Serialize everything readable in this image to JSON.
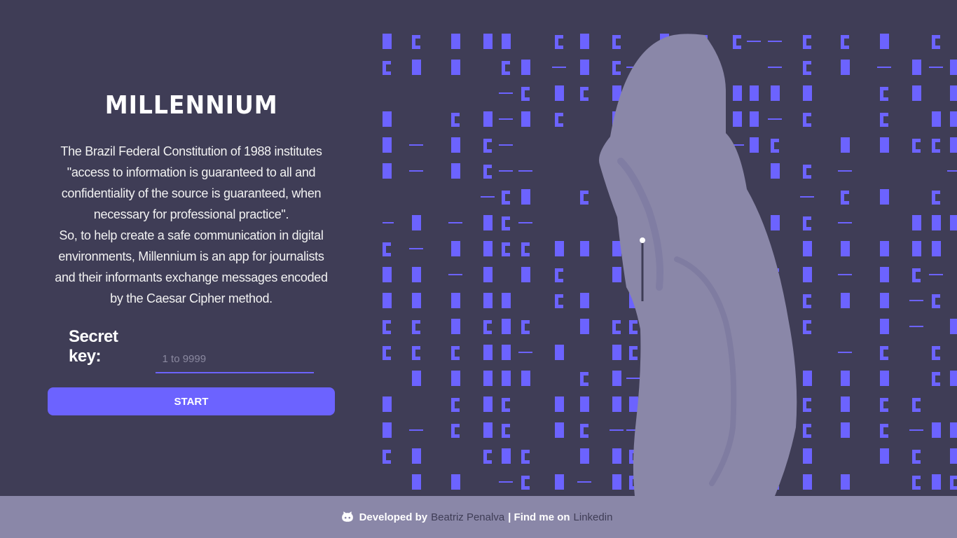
{
  "app": {
    "title": "MILLENNIUM"
  },
  "description": {
    "paragraph1": "The Brazil Federal Constitution of 1988 institutes \"access to information is guaranteed to all and confidentiality of the source is guaranteed, when necessary for professional practice\".",
    "paragraph2": "So, to help create a safe communication in digital environments, Millennium is an app for journalists and their informants exchange messages encoded by the Caesar Cipher method."
  },
  "form": {
    "key_label": "Secret key:",
    "key_placeholder": "1 to 9999",
    "key_value": "",
    "start_label": "START"
  },
  "footer": {
    "icon": "github-icon",
    "developed_by": "Developed by",
    "author": "Beatriz Penalva",
    "separator": "| Find me on",
    "link": "Linkedin"
  },
  "colors": {
    "background": "#3f3d56",
    "accent": "#6c63ff",
    "footer": "#8a87a8",
    "figure": "#8a87a8"
  }
}
